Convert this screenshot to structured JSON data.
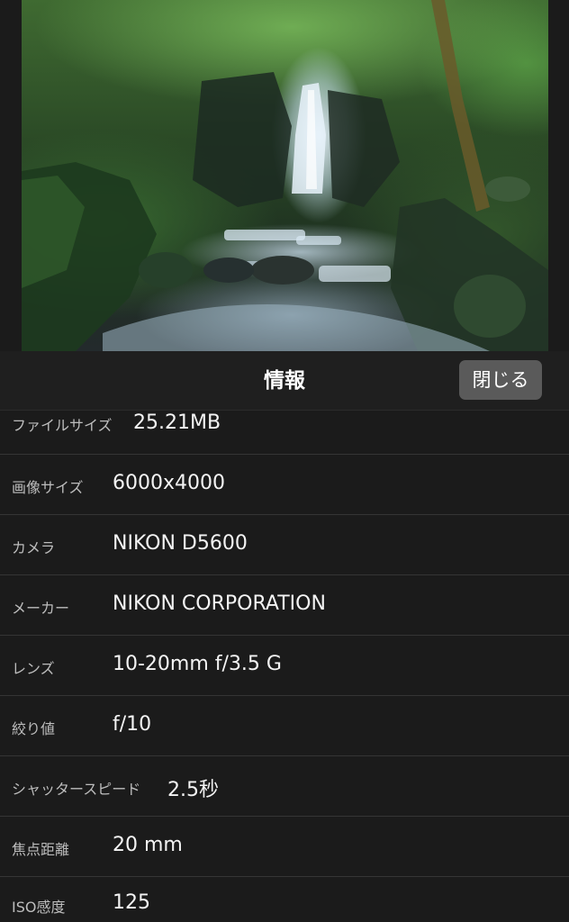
{
  "header": {
    "title": "情報",
    "close_label": "閉じる"
  },
  "photo": {
    "subject": "waterfall-forest-photo"
  },
  "info": {
    "rows": [
      {
        "label": "ファイルサイズ",
        "value": "25.21MB"
      },
      {
        "label": "画像サイズ",
        "value": "6000x4000"
      },
      {
        "label": "カメラ",
        "value": "NIKON D5600"
      },
      {
        "label": "メーカー",
        "value": "NIKON CORPORATION"
      },
      {
        "label": "レンズ",
        "value": "10-20mm f/3.5 G"
      },
      {
        "label": "絞り値",
        "value": "f/10"
      },
      {
        "label": "シャッタースピード",
        "value": "2.5秒"
      },
      {
        "label": "焦点距離",
        "value": "20 mm"
      },
      {
        "label": "ISO感度",
        "value": "125"
      }
    ]
  },
  "colors": {
    "background": "#1b1b1b",
    "header": "#1f1f1f",
    "button": "#5a5a5a",
    "divider": "#353535",
    "label": "#bdbdbd",
    "value": "#f4f4f4"
  }
}
